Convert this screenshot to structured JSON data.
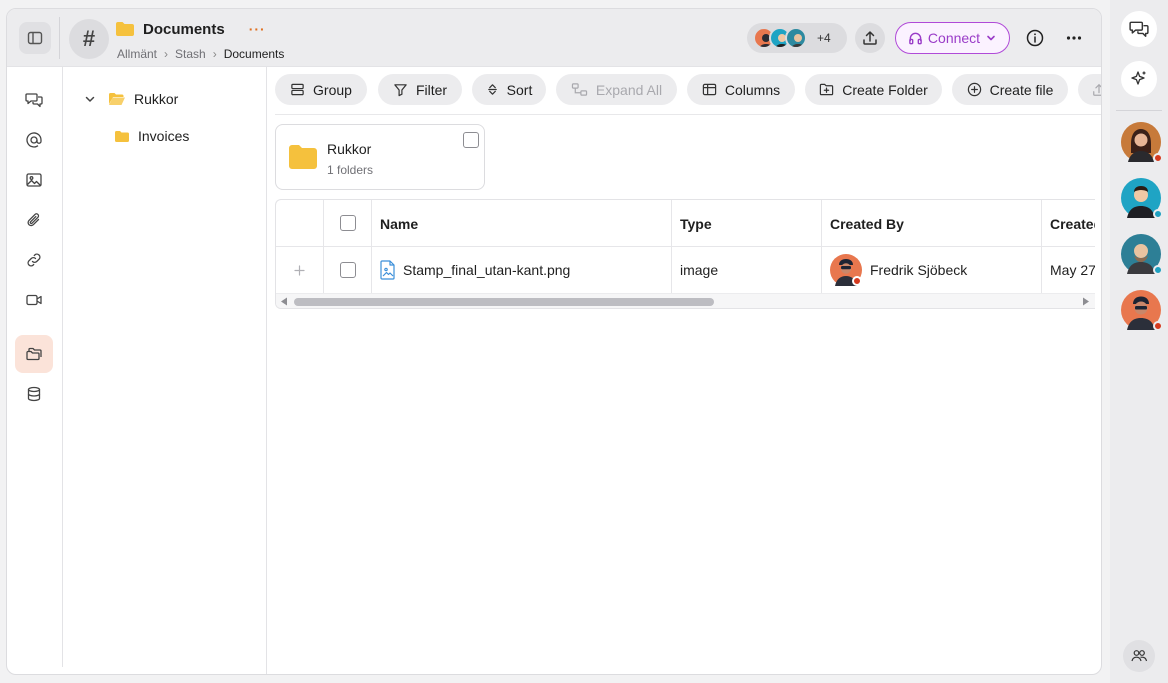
{
  "header": {
    "title": "Documents",
    "more_label": "···",
    "breadcrumbs": [
      "Allmänt",
      "Stash",
      "Documents"
    ],
    "participants_extra": "+4",
    "connect_label": "Connect"
  },
  "tree": {
    "items": [
      {
        "label": "Rukkor",
        "expanded": true
      },
      {
        "label": "Invoices"
      }
    ]
  },
  "toolbar": {
    "group": "Group",
    "filter": "Filter",
    "sort": "Sort",
    "expand_all": "Expand All",
    "columns": "Columns",
    "create_folder": "Create Folder",
    "create_file": "Create file"
  },
  "folder_card": {
    "name": "Rukkor",
    "meta": "1 folders"
  },
  "table": {
    "columns": [
      "Name",
      "Type",
      "Created By",
      "Created"
    ],
    "rows": [
      {
        "name": "Stamp_final_utan-kant.png",
        "type": "image",
        "created_by": "Fredrik Sjöbeck",
        "created": "May 27"
      }
    ]
  },
  "colors": {
    "accent_purple": "#9a3cc8",
    "folder_yellow": "#f5c13d",
    "active_rail": "#fbe3d9",
    "status_red": "#d43a1f",
    "status_teal": "#1ea0c0"
  }
}
